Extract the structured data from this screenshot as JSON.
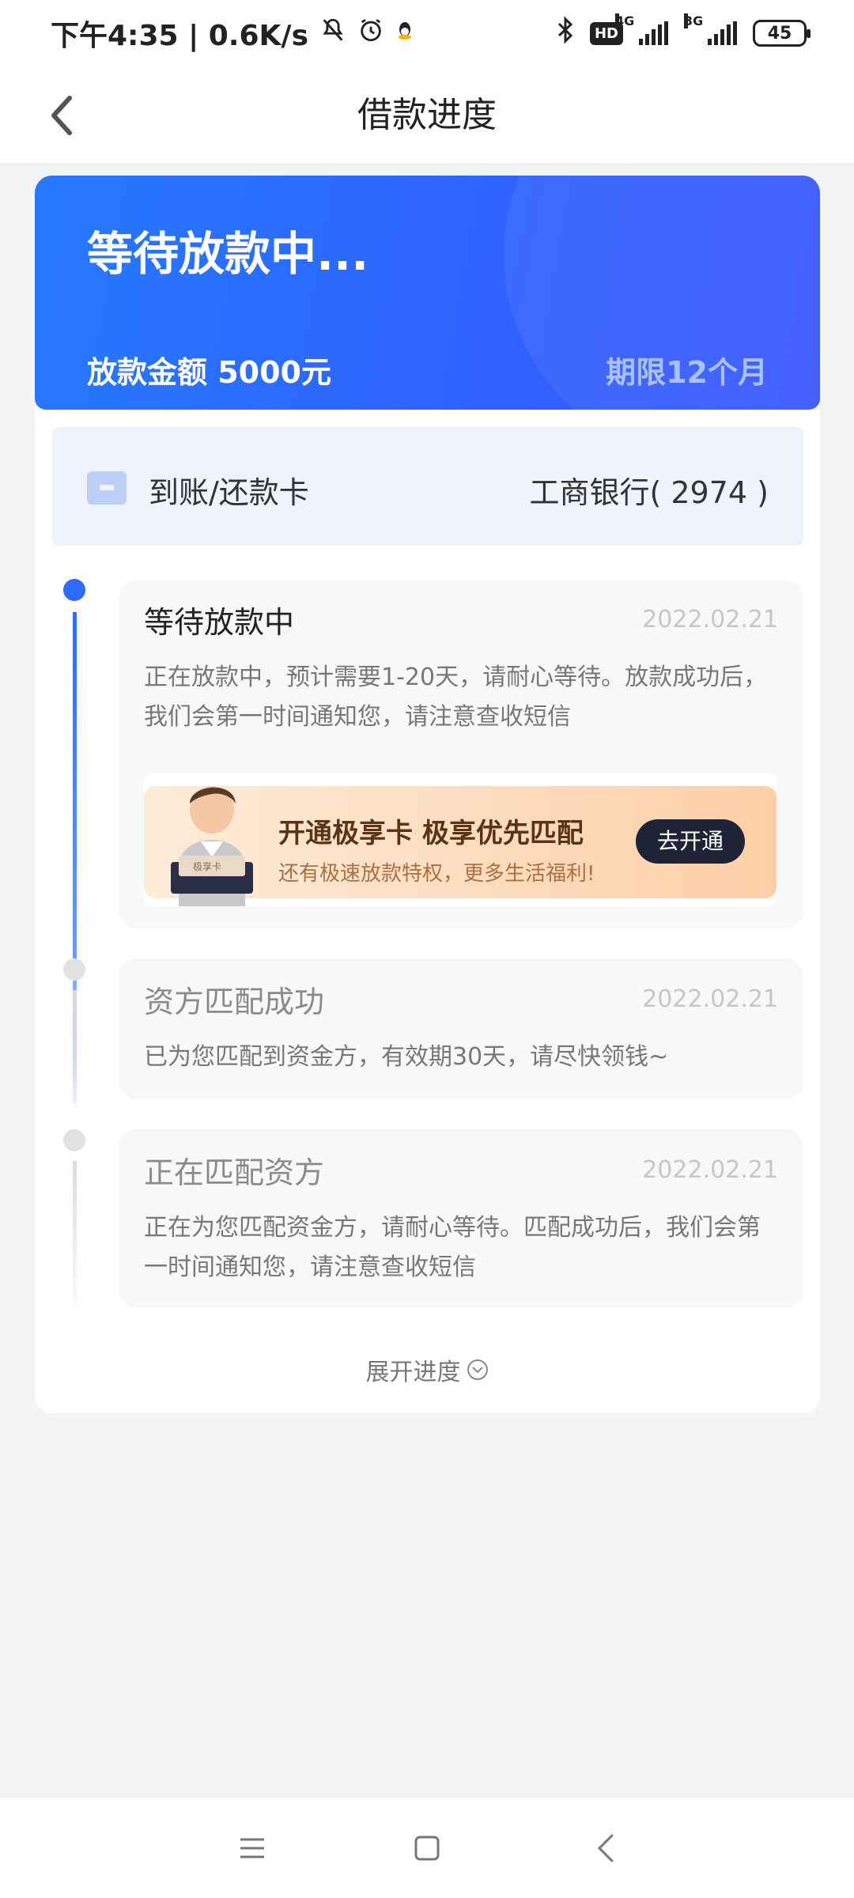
{
  "status_bar": {
    "left_text": "下午4:35 | 0.6K/s",
    "hd": "HD",
    "net1": "4G",
    "net2": "3G",
    "battery": "45"
  },
  "header": {
    "title": "借款进度"
  },
  "hero": {
    "status": "等待放款中...",
    "amount": "放款金额 5000元",
    "term": "期限12个月"
  },
  "card": {
    "label": "到账/还款卡",
    "value": "工商银行( 2974 )"
  },
  "steps": [
    {
      "title": "等待放款中",
      "date": "2022.02.21",
      "desc": "正在放款中，预计需要1-20天，请耐心等待。放款成功后，我们会第一时间通知您，请注意查收短信"
    },
    {
      "title": "资方匹配成功",
      "date": "2022.02.21",
      "desc": "已为您匹配到资金方，有效期30天，请尽快领钱~"
    },
    {
      "title": "正在匹配资方",
      "date": "2022.02.21",
      "desc": "正在为您匹配资金方，请耐心等待。匹配成功后，我们会第一时间通知您，请注意查收短信"
    }
  ],
  "promo": {
    "title": "开通极享卡 极享优先匹配",
    "subtitle": "还有极速放款特权，更多生活福利!",
    "button": "去开通",
    "card_text": "极享卡"
  },
  "expand": {
    "label": "展开进度"
  },
  "colors": {
    "accent": "#2f6bff",
    "hero_start": "#2679ff",
    "hero_end": "#3a57ff"
  }
}
